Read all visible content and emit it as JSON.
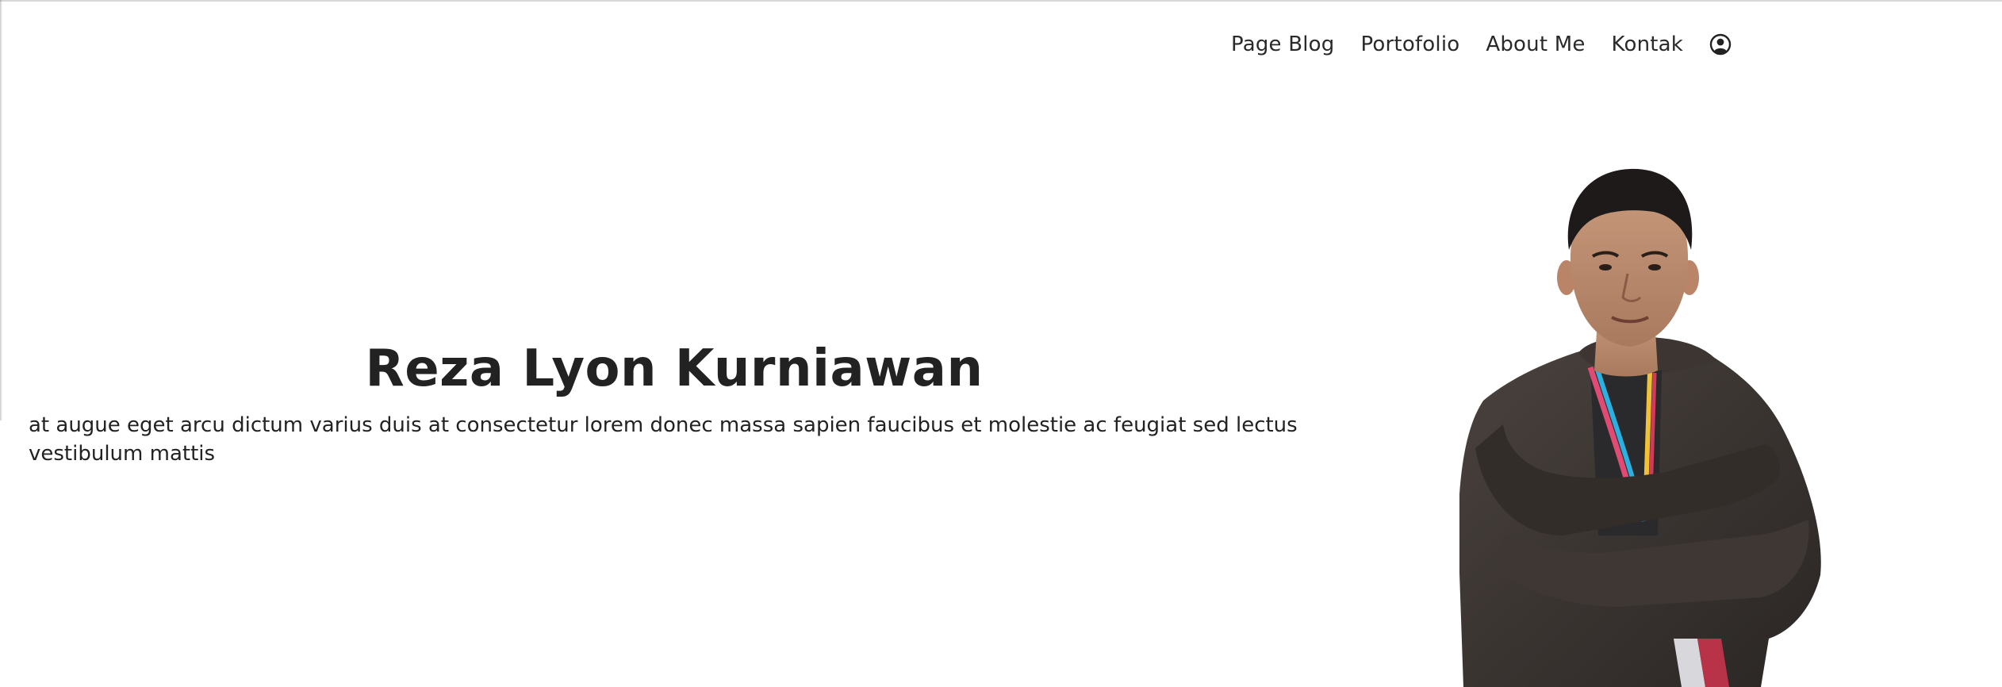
{
  "nav": {
    "items": [
      {
        "label": "Page Blog"
      },
      {
        "label": "Portofolio"
      },
      {
        "label": "About Me"
      },
      {
        "label": "Kontak"
      }
    ],
    "account_icon": "user-circle-icon"
  },
  "hero": {
    "title": "Reza Lyon Kurniawan",
    "description": "at augue eget arcu dictum varius duis at consectetur lorem donec massa sapien faucibus et molestie ac feugiat sed lectus vestibulum mattis"
  },
  "colors": {
    "text": "#222222",
    "background": "#ffffff"
  }
}
